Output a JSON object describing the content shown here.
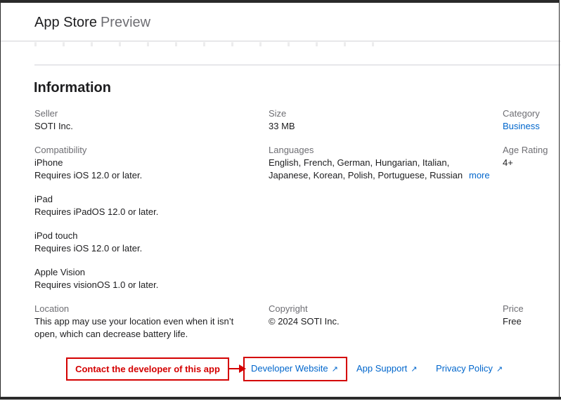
{
  "header": {
    "brand": "App Store",
    "suffix": "Preview"
  },
  "info": {
    "title": "Information",
    "seller": {
      "label": "Seller",
      "value": "SOTI Inc."
    },
    "size": {
      "label": "Size",
      "value": "33 MB"
    },
    "category": {
      "label": "Category",
      "value": "Business"
    },
    "compatibility": {
      "label": "Compatibility",
      "devices": [
        {
          "name": "iPhone",
          "req": "Requires iOS 12.0 or later."
        },
        {
          "name": "iPad",
          "req": "Requires iPadOS 12.0 or later."
        },
        {
          "name": "iPod touch",
          "req": "Requires iOS 12.0 or later."
        },
        {
          "name": "Apple Vision",
          "req": "Requires visionOS 1.0 or later."
        }
      ]
    },
    "languages": {
      "label": "Languages",
      "line1": "English, French, German, Hungarian, Italian,",
      "line2": "Japanese, Korean, Polish, Portuguese, Russian",
      "more": "more"
    },
    "age_rating": {
      "label": "Age Rating",
      "value": "4+"
    },
    "location": {
      "label": "Location",
      "line1": "This app may use your location even when it isn’t",
      "line2": "open, which can decrease battery life."
    },
    "copyright": {
      "label": "Copyright",
      "value": "© 2024 SOTI Inc."
    },
    "price": {
      "label": "Price",
      "value": "Free"
    }
  },
  "links": {
    "developer_website": "Developer Website",
    "app_support": "App Support",
    "privacy_policy": "Privacy Policy",
    "arrow_glyph": "↗"
  },
  "annotation": {
    "callout_text": "Contact the developer of this app",
    "color": "#d40000"
  },
  "colors": {
    "link": "#0066cc",
    "label": "#6e6e73",
    "text": "#1d1d1f"
  }
}
